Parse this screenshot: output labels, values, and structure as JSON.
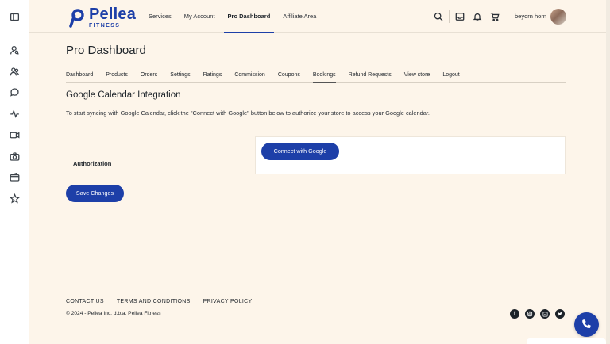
{
  "rail": {
    "icons": [
      "sidebar-toggle-icon",
      "user-search-icon",
      "users-icon",
      "chat-icon",
      "activity-icon",
      "video-icon",
      "camera-icon",
      "wallet-icon",
      "star-icon"
    ]
  },
  "header": {
    "logo_name": "Pellea",
    "logo_sub": "FITNESS",
    "nav": [
      "Services",
      "My Account",
      "Pro Dashboard",
      "Affiliate Area"
    ],
    "active_nav": "Pro Dashboard",
    "icons": [
      "search-icon",
      "inbox-icon",
      "bell-icon",
      "cart-icon"
    ],
    "username": "beyorn horn"
  },
  "page": {
    "title": "Pro Dashboard",
    "tabs": [
      "Dashboard",
      "Products",
      "Orders",
      "Settings",
      "Ratings",
      "Commission",
      "Coupons",
      "Bookings",
      "Refund Requests",
      "View store",
      "Logout"
    ],
    "active_tab": "Bookings",
    "section_title": "Google Calendar Integration",
    "description": "To start syncing with Google Calendar, click the \"Connect with Google\" button below to authorize your store to access your Google calendar.",
    "auth_label": "Authorization",
    "connect_button": "Connect with Google",
    "save_button": "Save Changes"
  },
  "footer": {
    "links": [
      "CONTACT US",
      "TERMS AND CONDITIONS",
      "PRIVACY POLICY"
    ],
    "copyright": "© 2024 - Pellea Inc. d.b.a. Pellea Fitness",
    "socials": [
      "facebook-icon",
      "instagram-icon",
      "linkedin-icon",
      "twitter-icon"
    ]
  },
  "colors": {
    "brand": "#1d3fa8",
    "background": "#fdf5ea",
    "text": "#1d2329"
  }
}
